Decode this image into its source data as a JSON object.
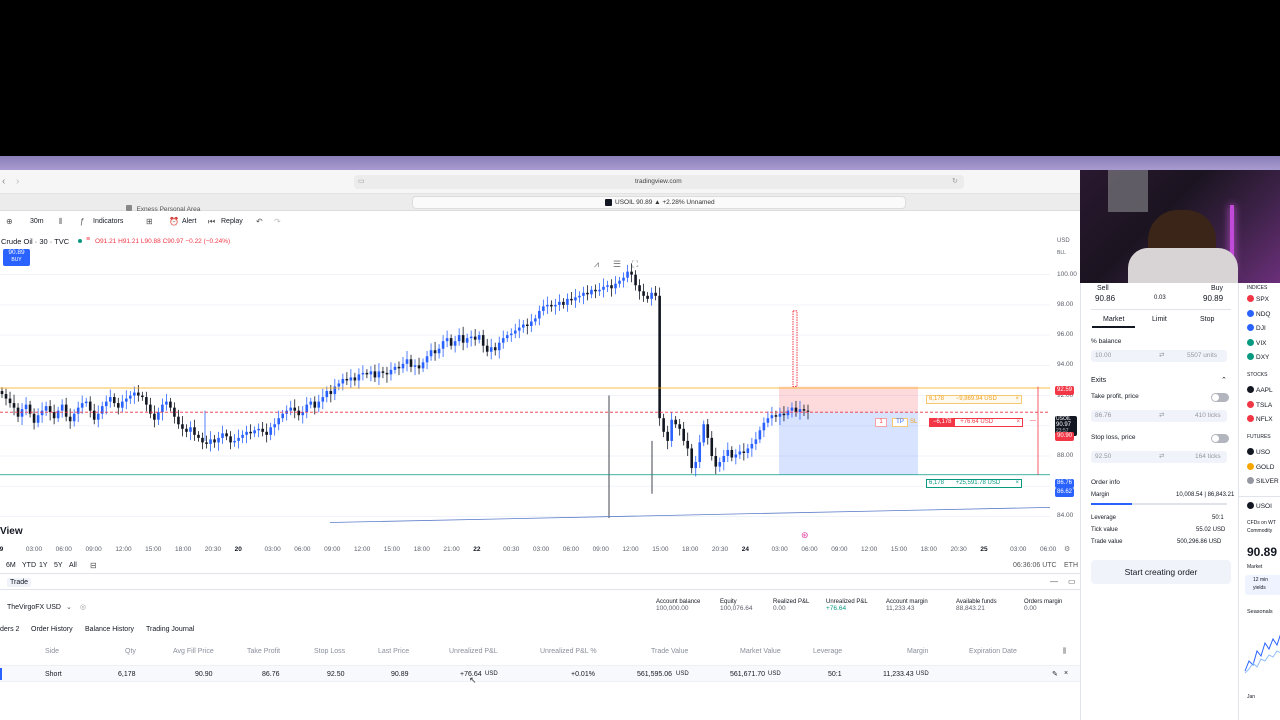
{
  "browser": {
    "url": "tradingview.com",
    "tab_left": "Exness Personal Area",
    "tab_active": "USOIL 90.89 ▲ +2.28% Unnamed"
  },
  "toolbar": {
    "interval": "30m",
    "indicators": "Indicators",
    "alert": "Alert",
    "replay": "Replay"
  },
  "chart": {
    "symbol": "Crude Oil · 30 · TVC",
    "ohlc": "O91.21 H91.21 L90.88 C90.97 −0.22 (−0.24%)",
    "buy_badge_price": "90.89",
    "buy_badge_label": "BUY",
    "currency": "USD",
    "currency_sub": "BLL",
    "view_label": "View",
    "y_ticks": [
      "100.00",
      "98.00",
      "96.00",
      "94.00",
      "92.00",
      "90.00",
      "88.00",
      "86.00",
      "84.00"
    ],
    "price_markers": {
      "tp_red": "92.59",
      "last": "90.97",
      "last_sub": "USOIL",
      "time_left": "23:57",
      "red2": "90.90",
      "green": "86.76",
      "blue": "86.62"
    },
    "order_tags": {
      "sl_qty": "6,178",
      "sl_pnl": "−9,869.94 USD",
      "pos_qty": "−6,178",
      "pos_pnl": "+76.64 USD",
      "tp_qty": "6,178",
      "tp_pnl": "+25,591.78 USD",
      "tp_label": "TP",
      "sl_label": "SL",
      "one": "1"
    },
    "x_ticks": [
      "19",
      "03:00",
      "06:00",
      "09:00",
      "12:00",
      "15:00",
      "18:00",
      "20:30",
      "20",
      "03:00",
      "06:00",
      "09:00",
      "12:00",
      "15:00",
      "18:00",
      "21:00",
      "22",
      "00:30",
      "03:00",
      "06:00",
      "09:00",
      "12:00",
      "15:00",
      "18:00",
      "20:30",
      "24",
      "03:00",
      "06:00",
      "09:00",
      "12:00",
      "15:00",
      "18:00",
      "20:30",
      "25",
      "03:00",
      "06:00"
    ],
    "ranges": [
      "6M",
      "YTD",
      "1Y",
      "5Y",
      "All"
    ],
    "clock": "06:36:06 UTC",
    "session": "ETH"
  },
  "chart_data": {
    "type": "candlestick",
    "ylim": [
      83.5,
      101.5
    ],
    "closes": [
      92.1,
      91.8,
      91.5,
      91.2,
      90.6,
      91.1,
      91.4,
      90.8,
      90.2,
      90.7,
      91.0,
      91.3,
      90.9,
      90.5,
      91.0,
      91.4,
      90.6,
      90.3,
      90.8,
      91.2,
      91.5,
      91.6,
      91.0,
      90.4,
      90.8,
      91.3,
      91.6,
      91.9,
      91.5,
      91.2,
      91.6,
      91.8,
      92.0,
      92.2,
      92.0,
      91.9,
      91.4,
      90.8,
      90.4,
      90.9,
      91.4,
      91.6,
      91.2,
      90.6,
      90.1,
      89.8,
      89.6,
      89.9,
      89.4,
      89.2,
      88.9,
      88.8,
      89.1,
      88.9,
      89.2,
      89.5,
      89.3,
      88.9,
      89.0,
      89.2,
      89.4,
      89.6,
      89.5,
      89.7,
      89.8,
      89.6,
      89.4,
      89.9,
      90.1,
      90.5,
      90.8,
      91.0,
      91.2,
      91.0,
      90.7,
      90.9,
      91.4,
      91.6,
      91.2,
      91.6,
      91.9,
      92.3,
      92.1,
      92.6,
      92.8,
      93.1,
      93.0,
      93.2,
      93.0,
      93.4,
      93.5,
      93.4,
      93.6,
      93.2,
      93.6,
      93.5,
      93.4,
      93.7,
      93.9,
      93.8,
      94.1,
      94.4,
      93.9,
      94.0,
      93.8,
      94.2,
      94.6,
      95.0,
      94.8,
      95.1,
      95.6,
      95.8,
      95.3,
      95.6,
      96.0,
      95.5,
      95.8,
      95.9,
      95.7,
      96.0,
      95.3,
      94.9,
      95.2,
      95.0,
      95.5,
      95.8,
      96.0,
      96.1,
      96.3,
      96.5,
      96.7,
      96.6,
      96.9,
      97.1,
      97.6,
      97.9,
      98.0,
      97.9,
      98.0,
      98.2,
      98.0,
      98.4,
      98.3,
      98.5,
      98.6,
      98.8,
      98.7,
      99.0,
      98.9,
      99.0,
      99.2,
      99.3,
      99.1,
      99.4,
      99.6,
      99.8,
      100.2,
      100.0,
      99.3,
      98.9,
      98.6,
      98.4,
      98.8,
      98.6,
      90.5,
      89.6,
      89.0,
      90.4,
      90.1,
      89.8,
      89.0,
      88.5,
      87.2,
      87.6,
      88.9,
      90.1,
      89.2,
      88.0,
      87.3,
      87.6,
      88.0,
      88.4,
      87.9,
      88.1,
      88.3,
      88.2,
      88.5,
      88.8,
      89.1,
      89.7,
      90.2,
      90.5,
      90.7,
      90.6,
      90.8,
      90.7,
      91.0,
      91.2,
      90.9,
      91.1,
      91.0,
      90.97
    ]
  },
  "trading_panel": {
    "tabs": [
      "Trade"
    ],
    "account_selector": "TheVirgoFX USD",
    "stats": [
      {
        "label": "Account balance",
        "value": "100,000.00"
      },
      {
        "label": "Equity",
        "value": "100,076.64"
      },
      {
        "label": "Realized P&L",
        "value": "0.00"
      },
      {
        "label": "Unrealized P&L",
        "value": "+76.64"
      },
      {
        "label": "Account margin",
        "value": "11,233.43"
      },
      {
        "label": "Available funds",
        "value": "88,843.21"
      },
      {
        "label": "Orders margin",
        "value": "0.00"
      }
    ],
    "subtabs": [
      "ders 2",
      "Order History",
      "Balance History",
      "Trading Journal"
    ],
    "columns": [
      "Side",
      "Qty",
      "Avg Fill Price",
      "Take Profit",
      "Stop Loss",
      "Last Price",
      "Unrealized P&L",
      "Unrealized P&L %",
      "Trade Value",
      "Market Value",
      "Leverage",
      "Margin",
      "Expiration Date"
    ],
    "row": {
      "side": "Short",
      "qty": "6,178",
      "avg_fill": "90.90",
      "take_profit": "86.76",
      "stop_loss": "92.50",
      "last_price": "90.89",
      "unrealized_pnl": "+76.64",
      "unrealized_pnl_unit": "USD",
      "unrealized_pct": "+0.01%",
      "trade_value": "561,595.06",
      "trade_value_unit": "USD",
      "market_value": "561,671.70",
      "market_value_unit": "USD",
      "leverage": "50:1",
      "margin": "11,233.43",
      "margin_unit": "USD"
    }
  },
  "order_panel": {
    "sell_label": "Sell",
    "sell_price": "90.86",
    "spread": "0.03",
    "buy_label": "Buy",
    "buy_price": "90.89",
    "tabs": [
      "Market",
      "Limit",
      "Stop"
    ],
    "balance_label": "% balance",
    "balance_value": "10.00",
    "balance_units": "5507 units",
    "exits_label": "Exits",
    "take_profit_label": "Take profit, price",
    "take_profit_value": "86.76",
    "take_profit_ticks": "410 ticks",
    "stop_loss_label": "Stop loss, price",
    "stop_loss_value": "92.50",
    "stop_loss_ticks": "164 ticks",
    "order_info_label": "Order info",
    "margin_label": "Margin",
    "margin_value": "10,008.54 | 86,843.21",
    "leverage_label": "Leverage",
    "leverage_value": "50:1",
    "tick_value_label": "Tick value",
    "tick_value_value": "55.02 USD",
    "trade_value_label": "Trade value",
    "trade_value_value": "500,296.86 USD",
    "cta": "Start creating order"
  },
  "watchlist": {
    "header": "INDICES",
    "items": [
      {
        "name": "SPX",
        "color": "#f23645"
      },
      {
        "name": "NDQ",
        "color": "#2962ff"
      },
      {
        "name": "DJI",
        "color": "#2962ff"
      },
      {
        "name": "VIX",
        "color": "#089981"
      },
      {
        "name": "DXY",
        "color": "#089981"
      }
    ],
    "stocks_header": "STOCKS",
    "stocks": [
      {
        "name": "AAPL",
        "color": "#131722"
      },
      {
        "name": "TSLA",
        "color": "#f23645"
      },
      {
        "name": "NFLX",
        "color": "#f23645"
      }
    ],
    "futures_header": "FUTURES",
    "futures": [
      {
        "name": "USO",
        "color": "#131722"
      },
      {
        "name": "GOLD",
        "color": "#f7a600"
      },
      {
        "name": "SILVER",
        "color": "#9598a1"
      }
    ],
    "detail_symbol": "USOI",
    "detail_desc": "CFDs on WT",
    "detail_sub": "Commodity",
    "detail_price": "90.89",
    "detail_market": "Market",
    "detail_news1": "12 min",
    "detail_news2": "yields",
    "seasonals": "Seasonals",
    "jan": "Jan"
  },
  "colors": {
    "accent": "#2962ff",
    "red": "#f23645",
    "green": "#089981",
    "purple_band": "#9a8fc6"
  }
}
